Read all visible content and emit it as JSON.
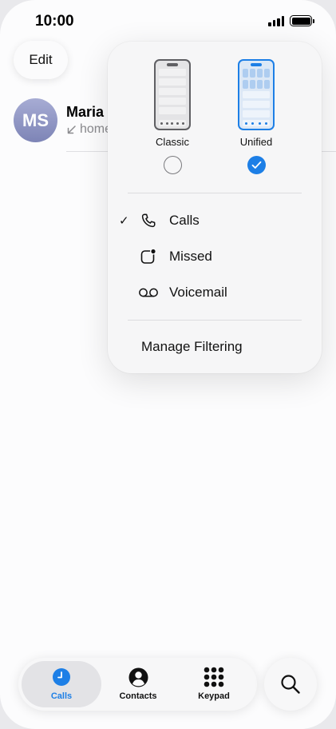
{
  "status_bar": {
    "time": "10:00"
  },
  "header": {
    "edit_label": "Edit"
  },
  "recent_call": {
    "initials": "MS",
    "name": "Maria",
    "detail": "home",
    "avatar_color": "#8f95c4"
  },
  "layout_picker": {
    "options": [
      {
        "label": "Classic",
        "selected": false
      },
      {
        "label": "Unified",
        "selected": true
      }
    ],
    "accent": "#1d7fe6"
  },
  "filter_menu": {
    "items": [
      {
        "label": "Calls",
        "icon": "phone-icon",
        "checked": true
      },
      {
        "label": "Missed",
        "icon": "missed-badge-icon",
        "checked": false
      },
      {
        "label": "Voicemail",
        "icon": "voicemail-icon",
        "checked": false
      }
    ],
    "checkmark": "✓",
    "manage_label": "Manage Filtering"
  },
  "tab_bar": {
    "tabs": [
      {
        "label": "Calls",
        "icon": "clock-icon",
        "active": true
      },
      {
        "label": "Contacts",
        "icon": "person-circle-icon",
        "active": false
      },
      {
        "label": "Keypad",
        "icon": "keypad-grid-icon",
        "active": false
      }
    ],
    "search_icon": "search-icon"
  }
}
